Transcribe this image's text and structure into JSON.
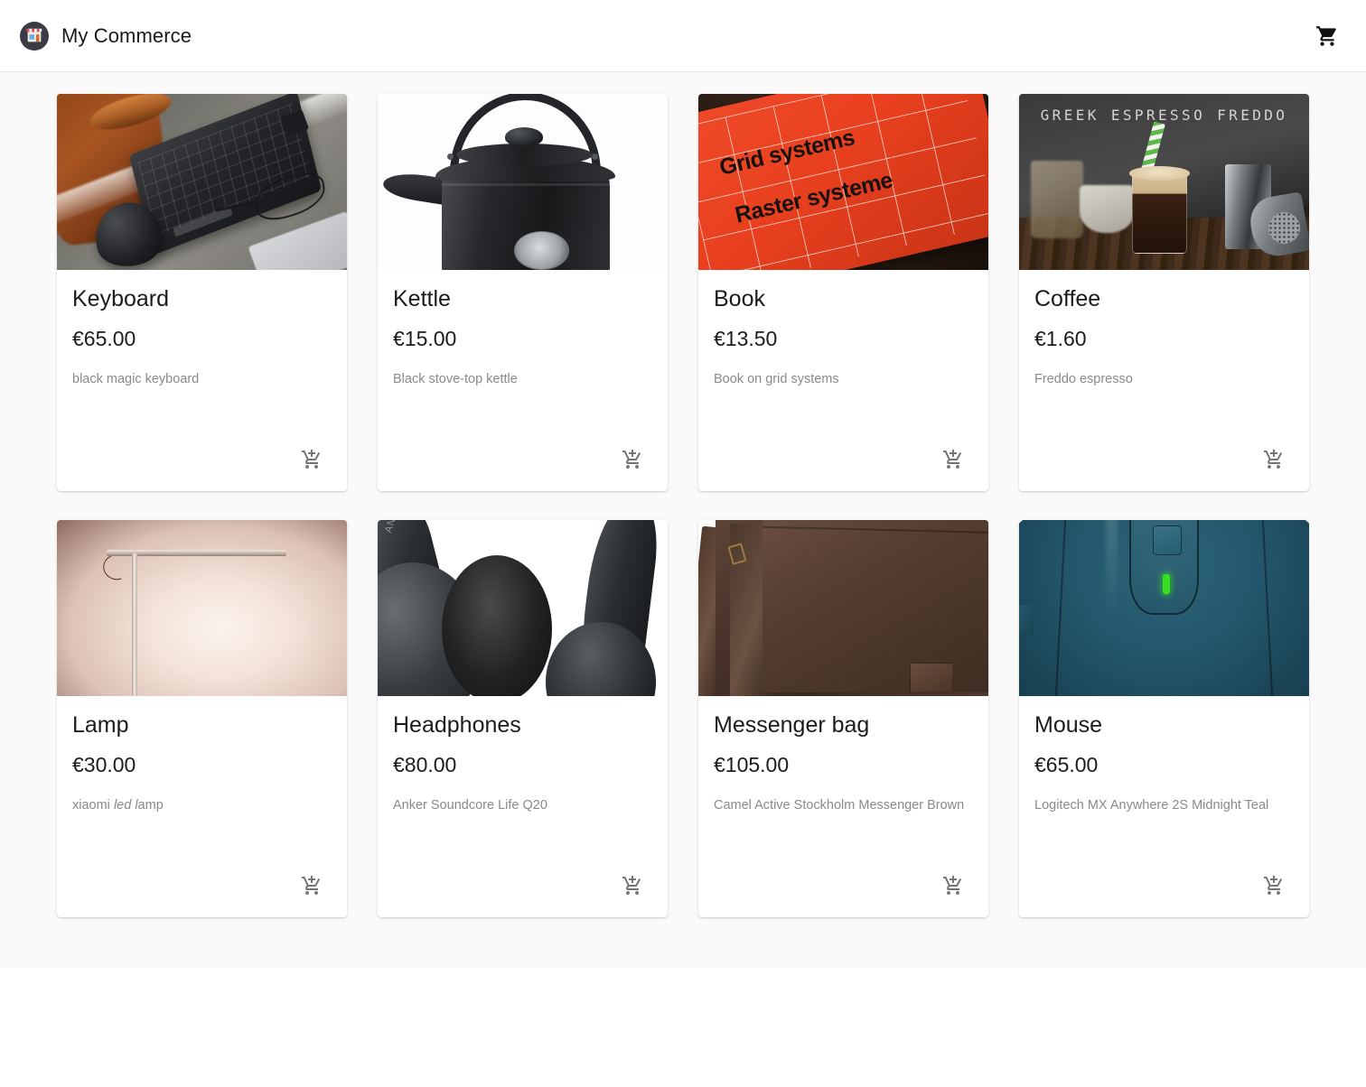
{
  "header": {
    "brand_title": "My Commerce",
    "logo_icon": "storefront-icon",
    "cart_icon": "shopping-cart-icon"
  },
  "theme": {
    "page_background": "#ffffff",
    "content_background": "#fafafa",
    "card_background": "#ffffff",
    "title_color": "#1c1c1c",
    "description_color": "#8a8a8a",
    "icon_color": "#757575"
  },
  "products": [
    {
      "name": "Keyboard",
      "price": "€65.00",
      "description": "black magic keyboard",
      "image_alt": "black keyboard and mouse on gray desk mat with glasses",
      "add_to_cart_icon": "add-shopping-cart-icon"
    },
    {
      "name": "Kettle",
      "price": "€15.00",
      "description": "Black stove-top kettle",
      "image_alt": "black stove-top kettle with round badge on white background",
      "add_to_cart_icon": "add-shopping-cart-icon"
    },
    {
      "name": "Book",
      "price": "€13.50",
      "description": "Book on grid systems",
      "image_alt": "orange Grid systems Raster systeme book on dark wood table",
      "image_text_line1": "Grid systems",
      "image_text_line2": "Raster systeme",
      "add_to_cart_icon": "add-shopping-cart-icon"
    },
    {
      "name": "Coffee",
      "price": "€1.60",
      "description": "Freddo espresso",
      "image_alt": "iced espresso freddo in a glass with green straw and shakers",
      "image_text": "GREEK ESPRESSO FREDDO",
      "add_to_cart_icon": "add-shopping-cart-icon"
    },
    {
      "name": "Lamp",
      "price": "€30.00",
      "description_prefix": "xiaomi ",
      "description_italic": "led l",
      "description_suffix": "amp",
      "description": "xiaomi led lamp",
      "image_alt": "minimal LED desk lamp bar glowing against a warm wall",
      "add_to_cart_icon": "add-shopping-cart-icon"
    },
    {
      "name": "Headphones",
      "price": "€80.00",
      "description": "Anker Soundcore Life Q20",
      "image_alt": "black over-ear Anker headphones close-up on white",
      "image_brand": "ANKER",
      "add_to_cart_icon": "add-shopping-cart-icon"
    },
    {
      "name": "Messenger bag",
      "price": "€105.00",
      "description": "Camel Active Stockholm Messenger Brown",
      "image_alt": "brown leather messenger bag with shoulder strap",
      "add_to_cart_icon": "add-shopping-cart-icon"
    },
    {
      "name": "Mouse",
      "price": "€65.00",
      "description": "Logitech MX Anywhere 2S Midnight Teal",
      "image_alt": "teal Logitech mouse close-up with green LED indicator",
      "add_to_cart_icon": "add-shopping-cart-icon"
    }
  ]
}
